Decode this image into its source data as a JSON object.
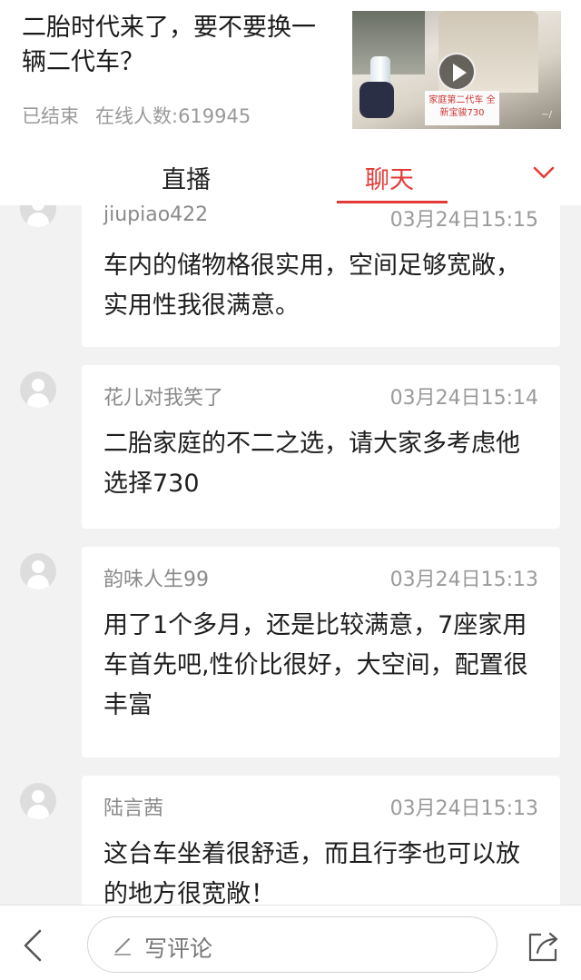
{
  "header": {
    "title": "二胎时代来了，要不要换一辆二代车？",
    "status": "已结束",
    "online_label": "在线人数:619945",
    "video": {
      "sign_text": "家庭第二代车 全新宝骏730"
    }
  },
  "tabs": [
    {
      "label": "直播"
    },
    {
      "label": "聊天"
    }
  ],
  "colors": {
    "accent": "#e53935",
    "card_bg": "#ffffff",
    "page_bg": "#f2f2f2"
  },
  "icons": {
    "tab_chevron": "chevron-down-icon",
    "avatar": "user-avatar-icon",
    "back": "back-arrow-icon",
    "pen": "pen-icon",
    "share": "share-icon",
    "play": "play-icon"
  },
  "comments": [
    {
      "user": "jiupiao422",
      "time": "03月24日15:15",
      "text": "车内的储物格很实用，空间足够宽敞，实用性我很满意。"
    },
    {
      "user": "花儿对我笑了",
      "time": "03月24日15:14",
      "text": "二胎家庭的不二之选，请大家多考虑他选择730"
    },
    {
      "user": "韵味人生99",
      "time": "03月24日15:13",
      "text": "用了1个多月，还是比较满意，7座家用车首先吧,性价比很好，大空间，配置很丰富"
    },
    {
      "user": "陆言茜",
      "time": "03月24日15:13",
      "text": "这台车坐着很舒适，而且行李也可以放的地方很宽敞！"
    }
  ],
  "bottom": {
    "comment_placeholder": "写评论"
  }
}
